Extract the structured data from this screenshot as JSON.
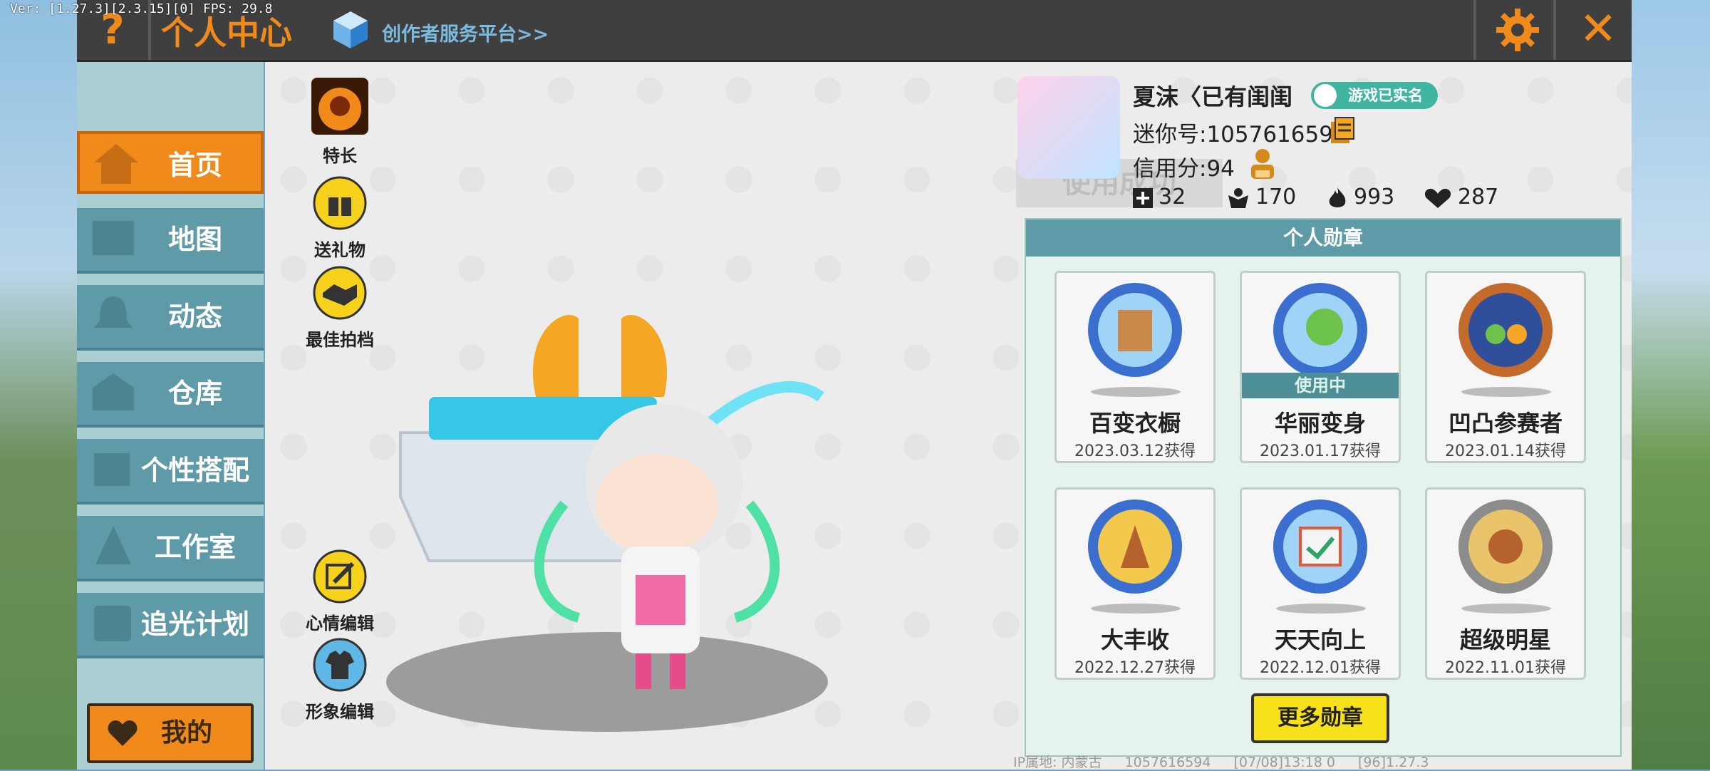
{
  "debug": {
    "fps_text": "Ver: [1.27.3][2.3.15][0] FPS: 29.8"
  },
  "header": {
    "help_icon": "question-mark",
    "title": "个人中心",
    "creator_link": "创作者服务平台>>",
    "settings_icon": "gear",
    "close_icon": "close-x",
    "accent": "#f08a1b"
  },
  "sidebar": {
    "items": [
      {
        "label": "首页",
        "icon": "house-icon",
        "active": true
      },
      {
        "label": "地图",
        "icon": "map-icon",
        "active": false
      },
      {
        "label": "动态",
        "icon": "bell-icon",
        "active": false
      },
      {
        "label": "仓库",
        "icon": "warehouse-icon",
        "active": false
      },
      {
        "label": "个性搭配",
        "icon": "outfit-icon",
        "active": false
      },
      {
        "label": "工作室",
        "icon": "studio-icon",
        "active": false
      },
      {
        "label": "追光计划",
        "icon": "light-plan-icon",
        "active": false
      }
    ],
    "mine_label": "我的"
  },
  "tools": {
    "specialty": "特长",
    "send_gift": "送礼物",
    "best_photo": "最佳拍档",
    "mood_edit": "心情编辑",
    "image_edit": "形象编辑"
  },
  "toast": "使用成功",
  "profile": {
    "name": "夏沫〈已有闺闺",
    "verified_badge": "游戏已实名",
    "mini_id": "迷你号:1057616594",
    "credit": "信用分:94",
    "stats": [
      {
        "icon": "add-friend-icon",
        "value": "32"
      },
      {
        "icon": "fans-icon",
        "value": "170"
      },
      {
        "icon": "fire-icon",
        "value": "993"
      },
      {
        "icon": "heart-icon",
        "value": "287"
      }
    ]
  },
  "medals": {
    "title": "个人勋章",
    "in_use_label": "使用中",
    "items": [
      {
        "name": "百变衣橱",
        "date": "2023.03.12获得",
        "in_use": false
      },
      {
        "name": "华丽变身",
        "date": "2023.01.17获得",
        "in_use": true
      },
      {
        "name": "凹凸参赛者",
        "date": "2023.01.14获得",
        "in_use": false
      },
      {
        "name": "大丰收",
        "date": "2022.12.27获得",
        "in_use": false
      },
      {
        "name": "天天向上",
        "date": "2022.12.01获得",
        "in_use": false
      },
      {
        "name": "超级明星",
        "date": "2022.11.01获得",
        "in_use": false
      }
    ],
    "more_button": "更多勋章"
  },
  "footer": {
    "ip": "IP属地: 内蒙古",
    "uid": "1057616594",
    "time": "[07/08]13:18 0",
    "version": "[96]1.27.3"
  }
}
